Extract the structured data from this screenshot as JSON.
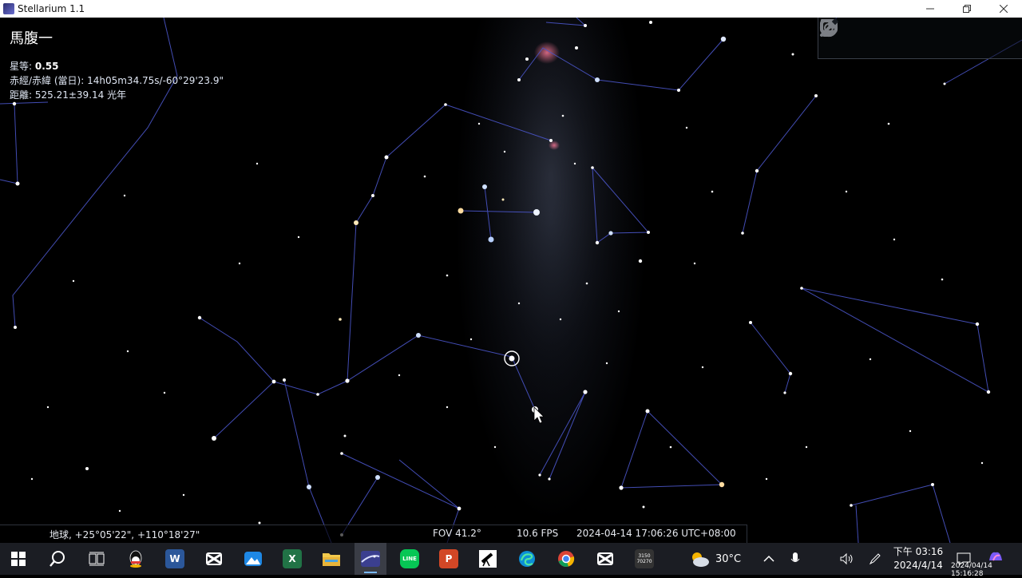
{
  "window": {
    "title": "Stellarium 1.1",
    "controls": [
      "minimize-icon",
      "restore-icon",
      "close-icon"
    ]
  },
  "object_info": {
    "name": "馬腹一",
    "magnitude_label": "星等:",
    "magnitude_value": "0.55",
    "radec_label": "赤經/赤緯 (當日):",
    "radec_value": "14h05m34.75s/-60°29'23.9\"",
    "distance_label": "距離:",
    "distance_value": "525.21±39.14",
    "distance_unit": "光年"
  },
  "top_toolbar": {
    "tools": [
      "trash-icon",
      "window-icon",
      "target-icon",
      "wrench-icon"
    ]
  },
  "status_bar": {
    "location": "地球, +25°05'22\", +110°18'27\"",
    "fov": "FOV 41.2°",
    "fps": "10.6 FPS",
    "datetime": "2024-04-14 17:06:26 UTC+08:00"
  },
  "taskbar": {
    "apps": [
      {
        "name": "start-icon",
        "label": "",
        "color": "#1e90ff"
      },
      {
        "name": "search-icon",
        "label": "",
        "color": "#ffffff"
      },
      {
        "name": "task-view-icon",
        "label": "",
        "color": "#ffffff"
      },
      {
        "name": "qq-icon",
        "label": "",
        "color": "#111111"
      },
      {
        "name": "word-icon",
        "label": "W",
        "color": "#2b579a"
      },
      {
        "name": "capcut-icon",
        "label": "",
        "color": "#000000"
      },
      {
        "name": "photos-icon",
        "label": "",
        "color": "#1e88e5"
      },
      {
        "name": "excel-icon",
        "label": "X",
        "color": "#217346"
      },
      {
        "name": "file-explorer-icon",
        "label": "",
        "color": "#f2c94c"
      },
      {
        "name": "stellarium-icon",
        "label": "",
        "color": "#3b3f8f"
      },
      {
        "name": "line-icon",
        "label": "LINE",
        "color": "#06c755"
      },
      {
        "name": "powerpoint-icon",
        "label": "P",
        "color": "#d24726"
      },
      {
        "name": "telescope-icon",
        "label": "",
        "color": "#ffffff"
      },
      {
        "name": "edge-icon",
        "label": "",
        "color": "#0c8fd6"
      },
      {
        "name": "chrome-icon",
        "label": "",
        "color": "#db4437"
      },
      {
        "name": "capcut-icon-2",
        "label": "",
        "color": "#000000"
      },
      {
        "name": "calendar-icon",
        "label": "3150\n70270",
        "color": "#333333"
      }
    ],
    "weather": {
      "icon": "weather-cloudy-sun-icon",
      "temp": "30°C"
    },
    "tray_icons": [
      "chevron-up-icon",
      "microphone-icon",
      "volume-icon",
      "pen-icon"
    ],
    "clock": {
      "time": "下午 03:16",
      "date": "2024/4/14"
    },
    "notification": "notification-icon",
    "overlay_stamp": "2024/04/14 15:16:28"
  }
}
